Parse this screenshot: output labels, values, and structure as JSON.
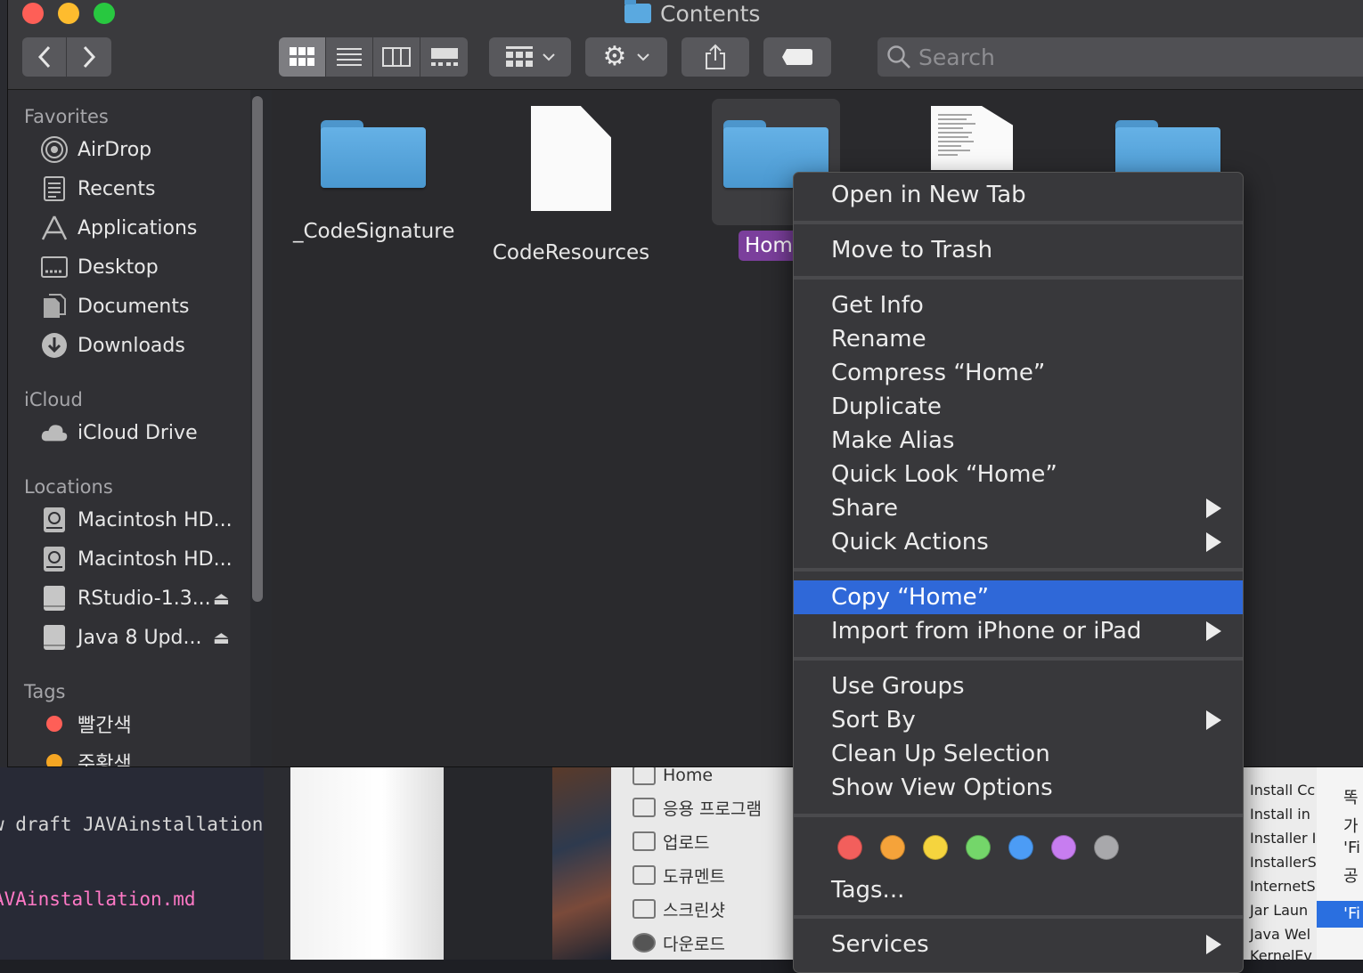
{
  "window": {
    "title": "Contents",
    "search_placeholder": "Search"
  },
  "sidebar": {
    "favorites_label": "Favorites",
    "favorites": [
      {
        "label": "AirDrop",
        "icon": "airdrop-icon"
      },
      {
        "label": "Recents",
        "icon": "recents-icon"
      },
      {
        "label": "Applications",
        "icon": "applications-icon"
      },
      {
        "label": "Desktop",
        "icon": "desktop-icon"
      },
      {
        "label": "Documents",
        "icon": "documents-icon"
      },
      {
        "label": "Downloads",
        "icon": "downloads-icon"
      }
    ],
    "icloud_label": "iCloud",
    "icloud": [
      {
        "label": "iCloud Drive",
        "icon": "cloud-icon"
      }
    ],
    "locations_label": "Locations",
    "locations": [
      {
        "label": "Macintosh HD...",
        "icon": "harddisk-icon"
      },
      {
        "label": "Macintosh HD...",
        "icon": "harddisk-icon"
      },
      {
        "label": "RStudio-1.3...",
        "icon": "disk-image-icon",
        "eject": "⏏"
      },
      {
        "label": "Java 8 Upd...",
        "icon": "disk-image-icon",
        "eject": "⏏"
      }
    ],
    "tags_label": "Tags",
    "tags": [
      {
        "label": "빨간색",
        "color": "#fe5f57"
      },
      {
        "label": "주황색",
        "color": "#f5a623"
      }
    ]
  },
  "files": [
    {
      "name": "_CodeSignature",
      "kind": "folder"
    },
    {
      "name": "CodeResources",
      "kind": "document"
    },
    {
      "name": "Home",
      "kind": "folder",
      "selected": true
    },
    {
      "name": "",
      "kind": "document-text"
    },
    {
      "name": "",
      "kind": "folder"
    }
  ],
  "context_menu": {
    "items": [
      {
        "label": "Open in New Tab"
      },
      {
        "label": "Move to Trash"
      },
      {
        "label": "Get Info"
      },
      {
        "label": "Rename"
      },
      {
        "label": "Compress “Home”"
      },
      {
        "label": "Duplicate"
      },
      {
        "label": "Make Alias"
      },
      {
        "label": "Quick Look “Home”"
      },
      {
        "label": "Share",
        "submenu": true
      },
      {
        "label": "Quick Actions",
        "submenu": true
      },
      {
        "label": "Copy “Home”",
        "highlighted": true
      },
      {
        "label": "Import from iPhone or iPad",
        "submenu": true
      },
      {
        "label": "Use Groups"
      },
      {
        "label": "Sort By",
        "submenu": true
      },
      {
        "label": "Clean Up Selection"
      },
      {
        "label": "Show View Options"
      },
      {
        "label": "Tags..."
      },
      {
        "label": "Services",
        "submenu": true
      }
    ],
    "tag_colors": [
      "#f25f5c",
      "#f5a33a",
      "#f5d43e",
      "#74d66a",
      "#4c9cf5",
      "#c77df0",
      "#a8a8ab"
    ]
  },
  "background": {
    "editor_line1": "w draft JAVAinstallation",
    "editor_line2": "AVAinstallation.md",
    "korean_items": [
      "Home",
      "응용 프로그램",
      "업로드",
      "도큐멘트",
      "스크린샷",
      "다운로드"
    ],
    "list_items": [
      "Install Cc",
      "Install in",
      "Installer I",
      "InstallerS",
      "InternetS",
      "Jar Laun",
      "Java Wel",
      "KernelEv"
    ],
    "right_items": [
      "똑",
      "가",
      "'Fi",
      "공"
    ],
    "right_selected": "'Fi"
  }
}
